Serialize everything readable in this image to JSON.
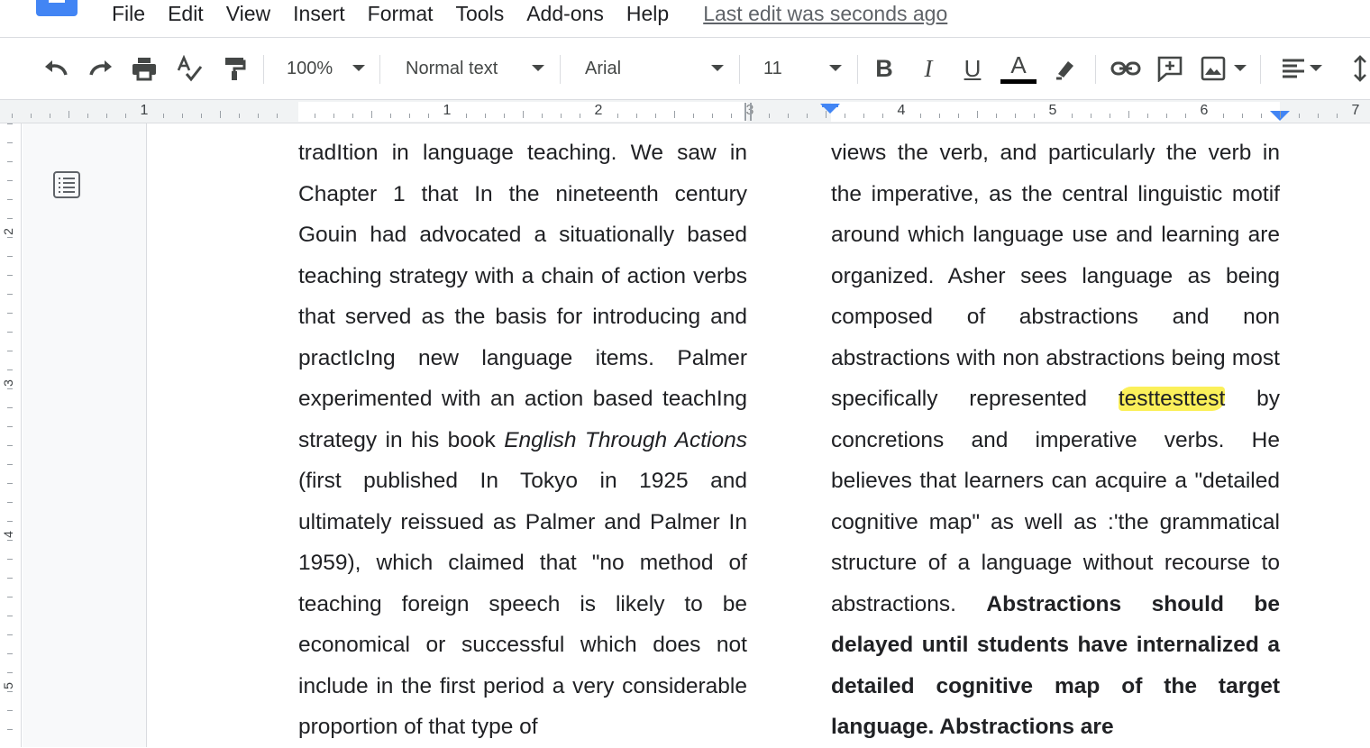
{
  "menubar": {
    "items": [
      "File",
      "Edit",
      "View",
      "Insert",
      "Format",
      "Tools",
      "Add-ons",
      "Help"
    ],
    "last_edit": "Last edit was seconds ago"
  },
  "toolbar": {
    "zoom": "100%",
    "style": "Normal text",
    "font": "Arial",
    "size": "11",
    "icons": [
      "undo-icon",
      "redo-icon",
      "print-icon",
      "spellcheck-icon",
      "paint-format-icon",
      "bold-icon",
      "italic-icon",
      "underline-icon",
      "text-color-icon",
      "highlight-icon",
      "link-icon",
      "comment-icon",
      "image-icon",
      "align-icon",
      "line-spacing-icon"
    ],
    "text_color_bar": "#000000",
    "accent": "#4285f4"
  },
  "ruler": {
    "numbers": [
      "1",
      "1",
      "2",
      "3",
      "4",
      "5",
      "6",
      "7"
    ]
  },
  "vruler": {
    "numbers": [
      "2",
      "3",
      "4",
      "5"
    ]
  },
  "document": {
    "left_column": {
      "part1": "tradItion in language teaching. We saw in Chapter 1 that In the nineteenth century Gouin had advocated a situationally based teaching strategy with a chain of action verbs that served as the basis for introducing and practIcIng new language items. Palmer experimented with an action based teachIng strategy in his book ",
      "italic": "English Through Actions",
      "part2": " (first published In Tokyo in 1925 and ultimately reissued as Palmer and Palmer In 1959), which claimed that \"no method of teaching foreign speech is likely to be economical or successful which does not include in the first period a very considerable proportion of that type of"
    },
    "right_column": {
      "part1": "views the verb, and particularly the verb in the imperative, as the central linguistic motif around which language use and learning are organized. Asher sees language as being composed of abstractions and non abstractions with non abstractions being most specifically represented ",
      "highlighted": "testtesttest",
      "part2": " by concretions and imperative verbs. He believes that learners can acquire a \"detailed cognitive map\" as well as :'the grammatical structure of a language without recourse to abstractions. ",
      "bold": "Abstractions should be delayed until students have internalized a detailed cognitive map of the target language. Abstractions are"
    },
    "highlight_color": "#fbf05a"
  }
}
